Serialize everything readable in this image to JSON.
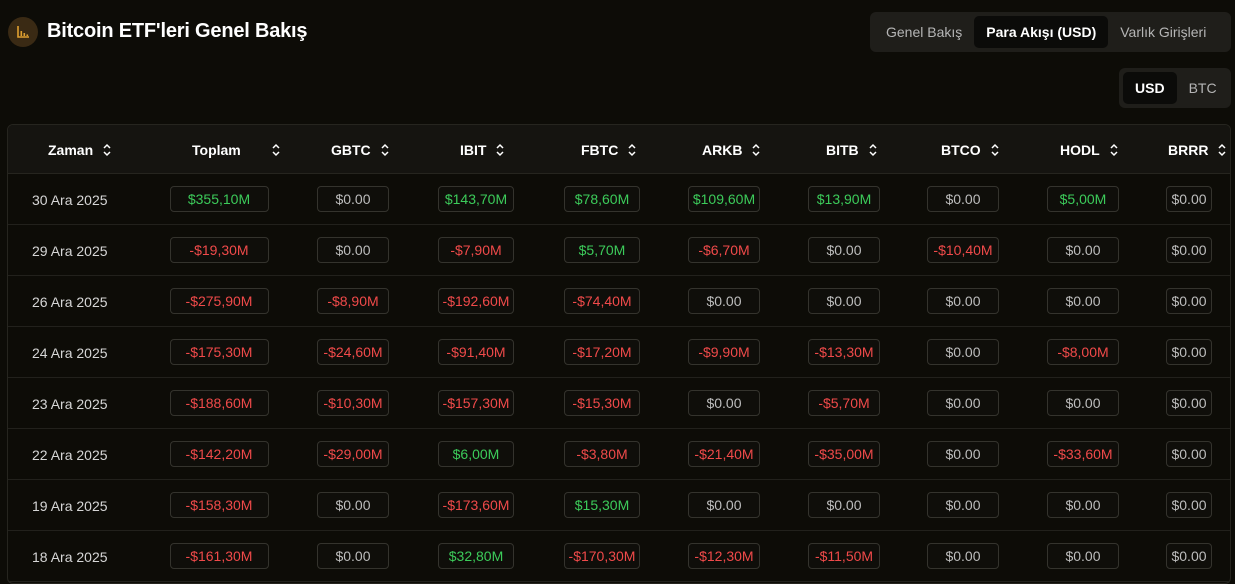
{
  "header": {
    "title": "Bitcoin ETF'leri Genel Bakış",
    "tabs": [
      "Genel Bakış",
      "Para Akışı (USD)",
      "Varlık Girişleri"
    ],
    "active_tab": 1
  },
  "unit_toggle": {
    "options": [
      "USD",
      "BTC"
    ],
    "active": 0
  },
  "table": {
    "columns": [
      "Zaman",
      "Toplam",
      "GBTC",
      "IBIT",
      "FBTC",
      "ARKB",
      "BITB",
      "BTCO",
      "HODL",
      "BRRR"
    ],
    "rows": [
      {
        "date": "30 Ara 2025",
        "values": [
          "$355,10M",
          "$0.00",
          "$143,70M",
          "$78,60M",
          "$109,60M",
          "$13,90M",
          "$0.00",
          "$5,00M",
          "$0.00"
        ]
      },
      {
        "date": "29 Ara 2025",
        "values": [
          "-$19,30M",
          "$0.00",
          "-$7,90M",
          "$5,70M",
          "-$6,70M",
          "$0.00",
          "-$10,40M",
          "$0.00",
          "$0.00"
        ]
      },
      {
        "date": "26 Ara 2025",
        "values": [
          "-$275,90M",
          "-$8,90M",
          "-$192,60M",
          "-$74,40M",
          "$0.00",
          "$0.00",
          "$0.00",
          "$0.00",
          "$0.00"
        ]
      },
      {
        "date": "24 Ara 2025",
        "values": [
          "-$175,30M",
          "-$24,60M",
          "-$91,40M",
          "-$17,20M",
          "-$9,90M",
          "-$13,30M",
          "$0.00",
          "-$8,00M",
          "$0.00"
        ]
      },
      {
        "date": "23 Ara 2025",
        "values": [
          "-$188,60M",
          "-$10,30M",
          "-$157,30M",
          "-$15,30M",
          "$0.00",
          "-$5,70M",
          "$0.00",
          "$0.00",
          "$0.00"
        ]
      },
      {
        "date": "22 Ara 2025",
        "values": [
          "-$142,20M",
          "-$29,00M",
          "$6,00M",
          "-$3,80M",
          "-$21,40M",
          "-$35,00M",
          "$0.00",
          "-$33,60M",
          "$0.00"
        ]
      },
      {
        "date": "19 Ara 2025",
        "values": [
          "-$158,30M",
          "$0.00",
          "-$173,60M",
          "$15,30M",
          "$0.00",
          "$0.00",
          "$0.00",
          "$0.00",
          "$0.00"
        ]
      },
      {
        "date": "18 Ara 2025",
        "values": [
          "-$161,30M",
          "$0.00",
          "$32,80M",
          "-$170,30M",
          "-$12,30M",
          "-$11,50M",
          "$0.00",
          "$0.00",
          "$0.00"
        ]
      }
    ]
  },
  "colors": {
    "positive": "#3ccb5a",
    "negative": "#f04a4a",
    "neutral": "#bdbdbd",
    "accent": "#e0a030"
  },
  "icons": {
    "logo": "chart-icon",
    "sort": "sort-icon"
  }
}
